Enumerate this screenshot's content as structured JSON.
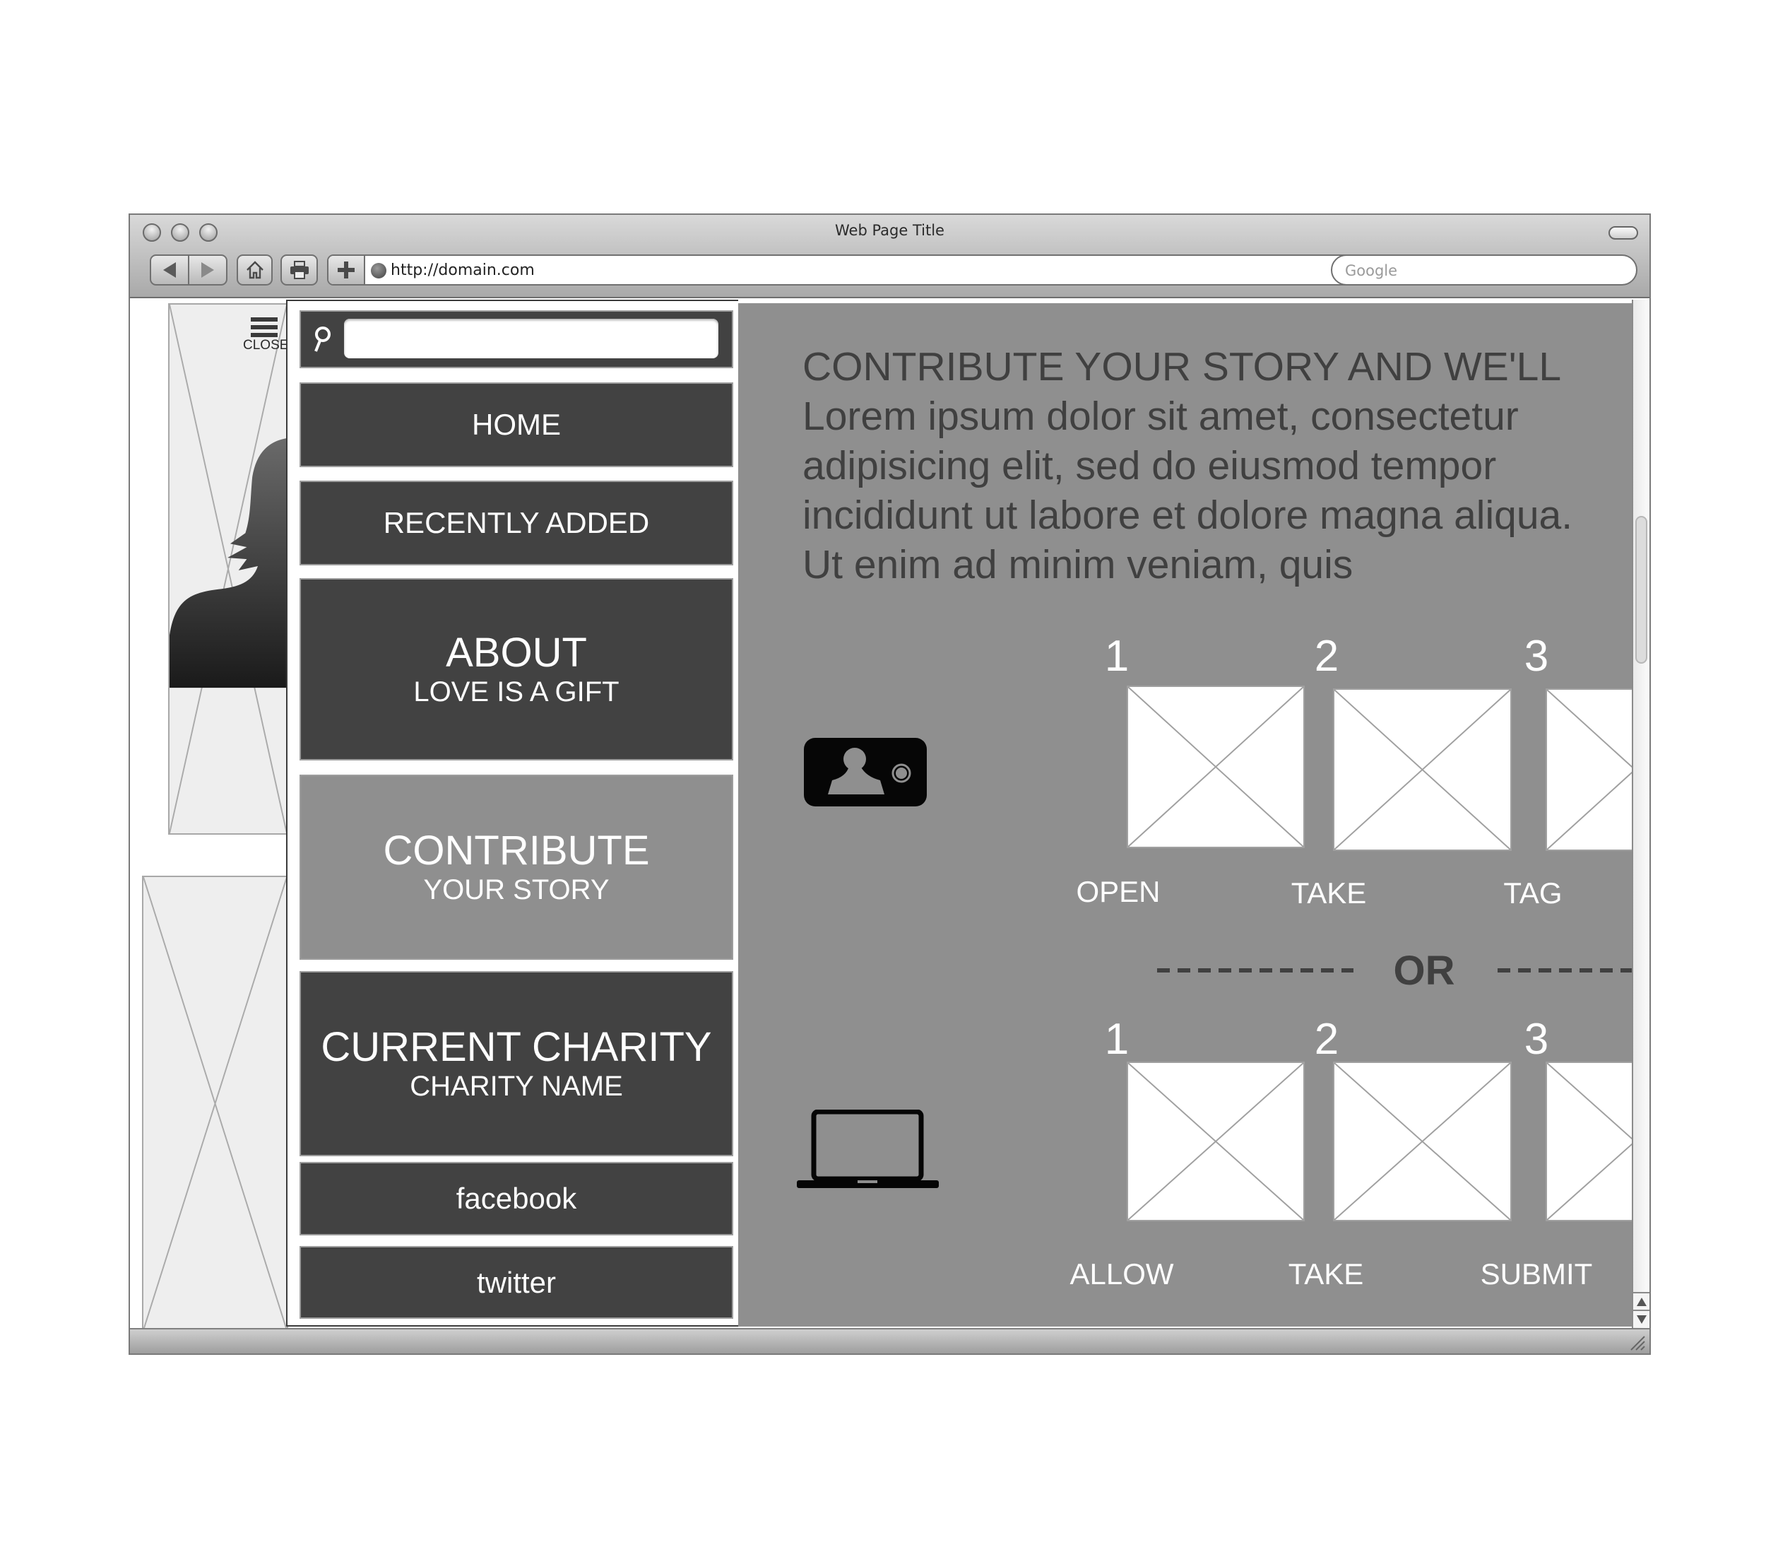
{
  "window": {
    "title": "Web Page Title",
    "url": "http://domain.com",
    "search_placeholder": "Google"
  },
  "toolbar": {
    "icons": [
      "back-arrow-icon",
      "forward-arrow-icon",
      "home-icon",
      "print-icon",
      "plus-icon",
      "globe-icon"
    ]
  },
  "sidebar_toggle": {
    "icon": "hamburger-icon",
    "label": "CLOSE"
  },
  "menu": {
    "search": {
      "value": "",
      "placeholder": "",
      "icon": "search-icon"
    },
    "items": [
      {
        "label": "HOME",
        "sub": ""
      },
      {
        "label": "RECENTLY ADDED",
        "sub": ""
      },
      {
        "label": "ABOUT",
        "sub": "LOVE IS A GIFT"
      },
      {
        "label": "CONTRIBUTE",
        "sub": "YOUR STORY",
        "active": true
      },
      {
        "label": "CURRENT CHARITY",
        "sub": "CHARITY NAME"
      },
      {
        "label": "facebook",
        "sub": ""
      },
      {
        "label": "twitter",
        "sub": ""
      }
    ]
  },
  "content": {
    "heading": "CONTRIBUTE YOUR STORY AND WE'LL",
    "body": "Lorem ipsum dolor sit amet, consectetur adipisicing elit, sed do eiusmod tempor incididunt ut labore et dolore magna aliqua. Ut enim ad minim veniam, quis",
    "mobile_flow": {
      "icon": "phone-camera-icon",
      "steps": [
        {
          "number": "1",
          "label": "OPEN"
        },
        {
          "number": "2",
          "label": "TAKE"
        },
        {
          "number": "3",
          "label": "TAG"
        }
      ]
    },
    "separator": "OR",
    "desktop_flow": {
      "icon": "laptop-icon",
      "steps": [
        {
          "number": "1",
          "label": "ALLOW"
        },
        {
          "number": "2",
          "label": "TAKE"
        },
        {
          "number": "3",
          "label": "SUBMIT"
        }
      ]
    }
  },
  "colors": {
    "menu_item": "#424242",
    "menu_item_active": "#8f8f8f",
    "content_bg": "#8f8f8f",
    "text_dark": "#404040"
  }
}
